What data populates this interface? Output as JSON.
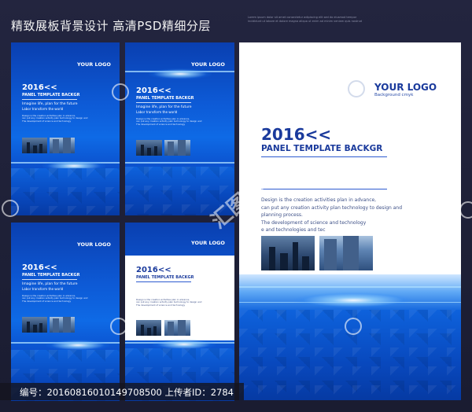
{
  "header": {
    "title": "精致展板背景设计 高清PSD精细分层",
    "small_text": "Lorem ipsum dolor sit amet consectetur adipiscing elit sed do eiusmod tempor incididunt ut labore et dolore magna aliqua ut enim ad minim veniam quis nostrud"
  },
  "panel": {
    "logo": "YOUR LOGO",
    "logo_sub": "Background cmyk",
    "year": "2016<<",
    "panel_title": "PANEL TEMPLATE BACKGR",
    "line1": "Imagine life, plan for the future",
    "line2": "Labor transform the world",
    "body1": "Design is the creation activities plan in advance,",
    "body2": "can put any creation activity plan technology to design and",
    "body3": "planning process.",
    "body4": "The development of science and technology",
    "body5": "e and technologies and tec"
  },
  "watermark": "汇图网",
  "footer": {
    "text": "编号：20160816010149708500 上传者ID：2784"
  },
  "colors": {
    "background": "#1b1d33",
    "panel_blue": "#0d5ad6",
    "text_dark_blue": "#1a3a9c"
  }
}
